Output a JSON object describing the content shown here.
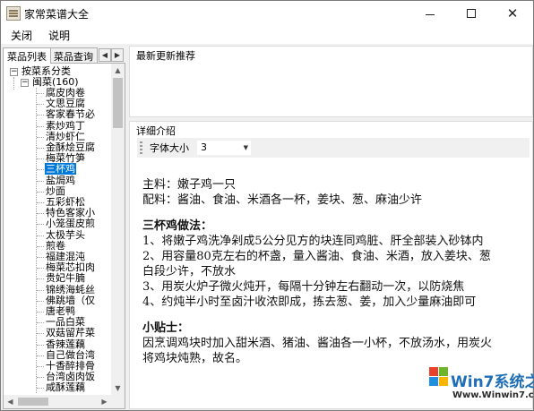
{
  "window": {
    "title": "家常菜谱大全",
    "controls": {
      "minimize_icon": "minimize-icon",
      "maximize_icon": "maximize-icon",
      "close_icon": "close-icon"
    }
  },
  "menu": {
    "items": [
      "关闭",
      "说明"
    ]
  },
  "left": {
    "tabs": [
      "菜品列表",
      "菜品查询"
    ],
    "tree": {
      "root": "按菜系分类",
      "category": "闽菜(160)",
      "items": [
        "腐皮肉卷",
        "文思豆腐",
        "客家春节必",
        "素炒鸡丁",
        "清炒虾仁",
        "金酥烩豆腐",
        "梅菜竹笋",
        "三杯鸡",
        "盐焗鸡",
        "炒面",
        "五彩虾松",
        "特色客家小",
        "小笼蛋皮煎",
        "太极芋头",
        "煎卷",
        "福建混沌",
        "梅菜芯扣肉",
        "贵妃牛腩",
        "锦绣海蚝丝",
        "佛跳墙（仅",
        "唐老鸭",
        "一品白菜",
        "双菇留芹菜",
        "香辣莲藕",
        "自己做台湾",
        "十香醉排骨",
        "台湾卤肉饭",
        "咸酥莲藕"
      ],
      "selected_index": 7
    }
  },
  "right": {
    "recent_title": "最新更新推荐",
    "detail_title": "详细介绍",
    "font_size_label": "字体大小",
    "font_size_value": "3",
    "content": {
      "main_ingredient": "主料：嫩子鸡一只",
      "seasoning": "配料：酱油、食油、米酒各一杯，姜块、葱、麻油少许",
      "method_title": "三杯鸡做法：",
      "steps": [
        "1、将嫩子鸡洗净剁成5公分见方的块连同鸡脏、肝全部装入砂钵内",
        "2、用容量80克左右的杯盏，量入酱油、食油、米酒，放入姜块、葱",
        "白段少许，不放水",
        "3、用炭火炉子微火炖开，每隔十分钟左右翻动一次，以防烧焦",
        "4、约炖半小时至卤汁收浓即成，拣去葱、姜，加入少量麻油即可"
      ],
      "tips_title": "小贴士：",
      "tips": [
        "因烹调鸡块时加入甜米酒、猪油、酱油各一小杯，不放汤水，用炭火",
        "将鸡块炖熟，故名。"
      ]
    }
  },
  "watermark": {
    "brand_prefix": "Win7",
    "brand_suffix": "系统之家",
    "url": "Www.Winwin7.com",
    "colors": {
      "red": "#e8412c",
      "green": "#6cb52d",
      "blue": "#1f8fe0",
      "yellow": "#f7b500"
    }
  }
}
